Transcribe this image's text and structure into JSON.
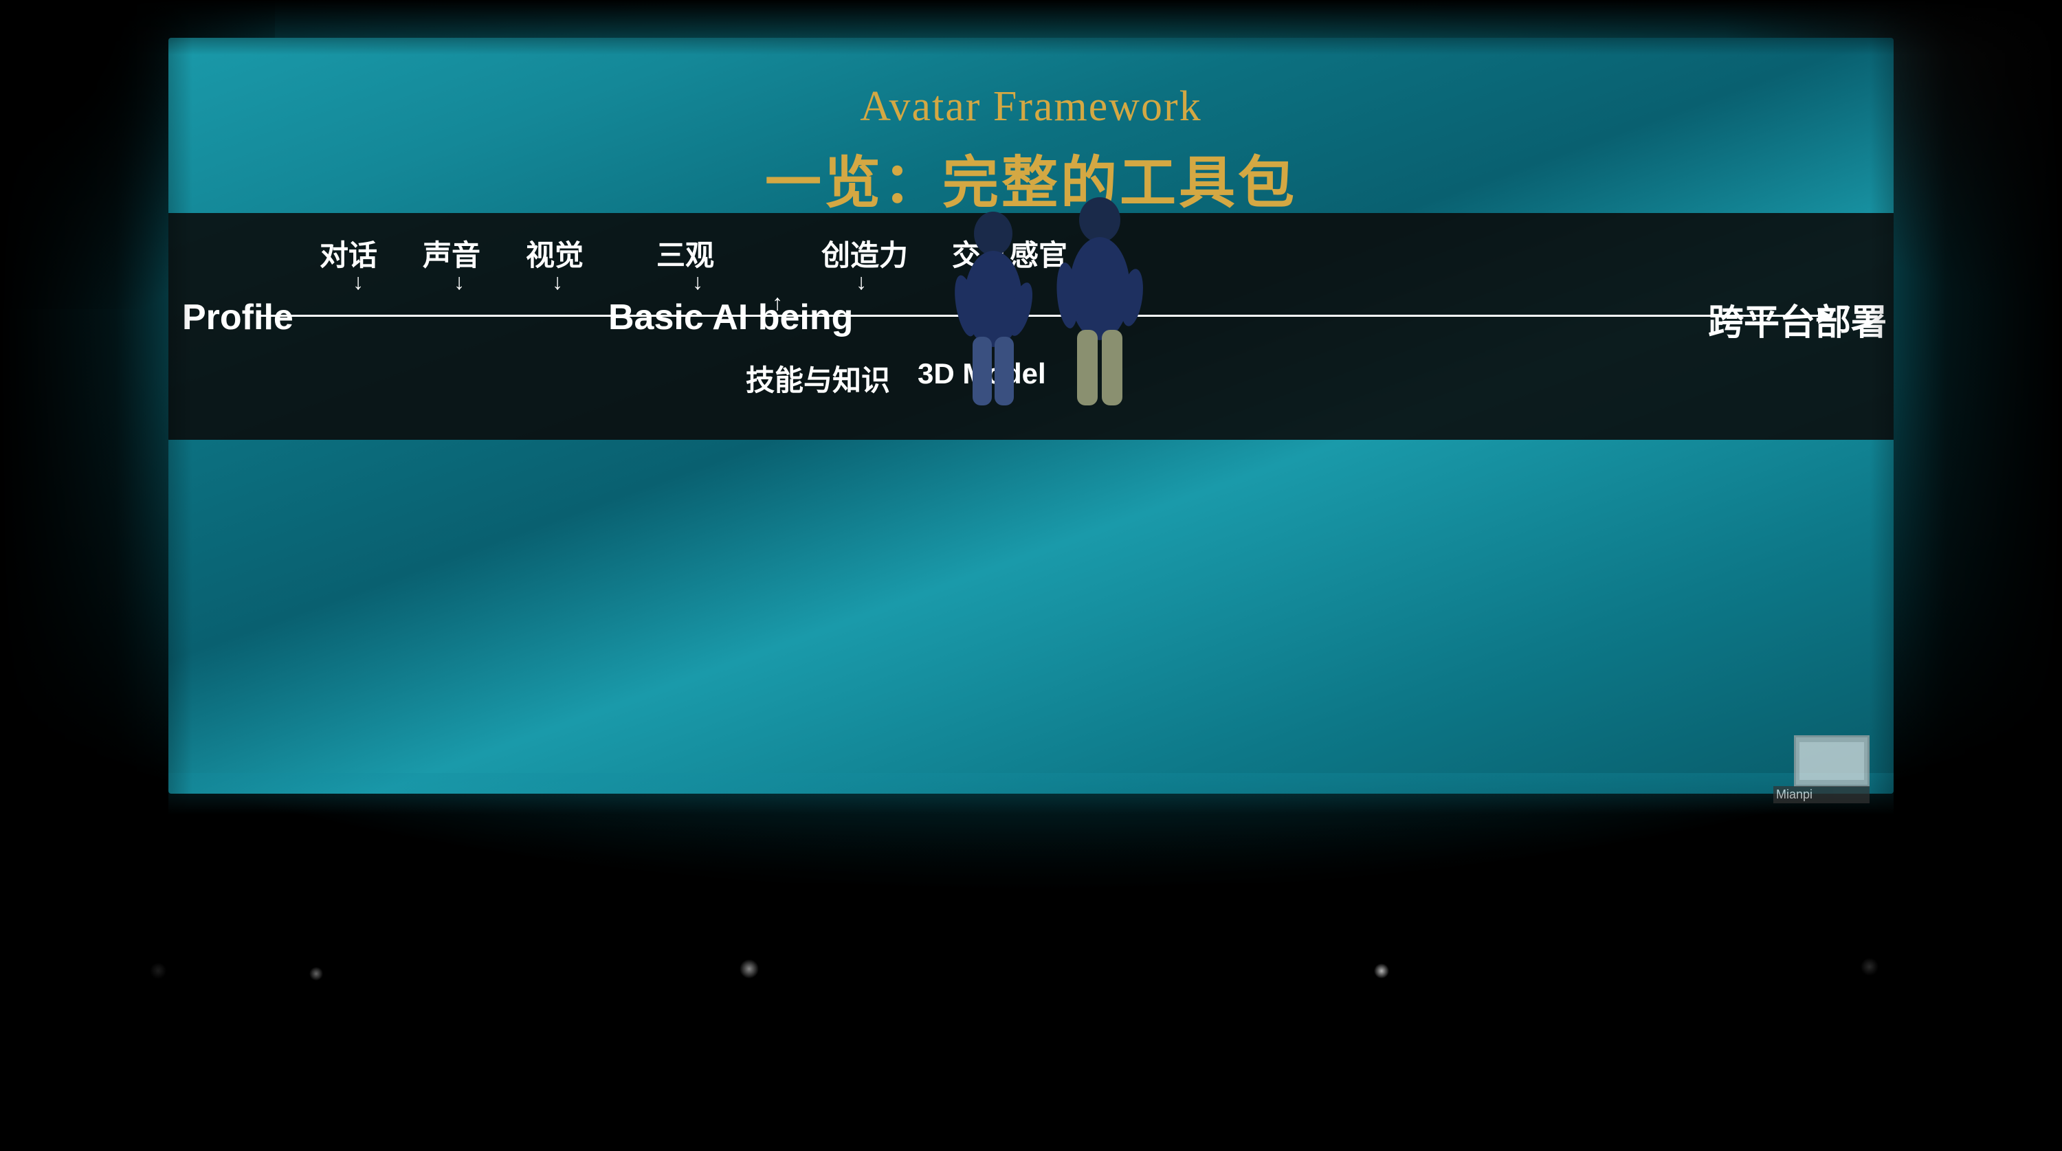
{
  "scene": {
    "background_color": "#000"
  },
  "slide": {
    "title_en": "Avatar Framework",
    "title_zh": "一览：完整的工具包",
    "diagram": {
      "left_label": "Profile",
      "center_label": "Basic AI being",
      "right_label": "跨平台部署",
      "above_labels": [
        "对话",
        "声音",
        "视觉",
        "三观",
        "创造力",
        "交互感官"
      ],
      "below_labels": [
        "技能与知识",
        "3D Model"
      ],
      "line_color": "#ffffff",
      "dot_color": "#d4a843"
    }
  },
  "monitor": {
    "brand_text": "Mianpi"
  }
}
